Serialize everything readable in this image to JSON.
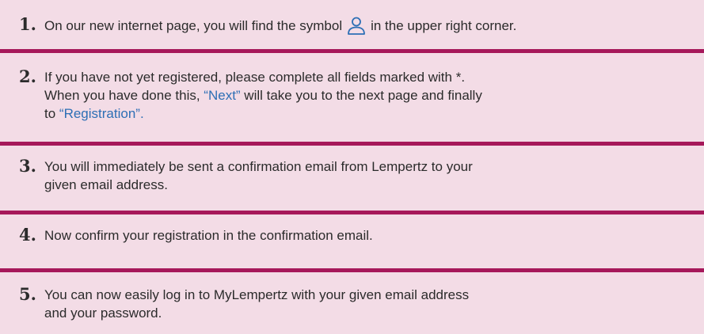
{
  "steps": [
    {
      "number": "1.",
      "text_before_icon": "On our new internet page, you will find the symbol",
      "text_after_icon": "in the upper right corner."
    },
    {
      "number": "2.",
      "line1": "If you have not yet registered, please complete all fields marked with *.",
      "line2_before": "When you have done this, ",
      "link_next": "“Next”",
      "line2_after": " will take you to the next page and finally",
      "line3_before": "to ",
      "link_registration": "“Registration”."
    },
    {
      "number": "3.",
      "line1": "You will immediately be sent a confirmation email from Lempertz to your",
      "line2": "given email address."
    },
    {
      "number": "4.",
      "line1": "Now confirm your registration in the confirmation email."
    },
    {
      "number": "5.",
      "line1": "You can now easily log in to MyLempertz with your given email address",
      "line2": "and your password."
    }
  ],
  "colors": {
    "background": "#f3dce6",
    "divider": "#a6185a",
    "link": "#2d6fb5",
    "icon": "#2d6fb5"
  },
  "icons": {
    "step1_symbol": "user-icon"
  }
}
